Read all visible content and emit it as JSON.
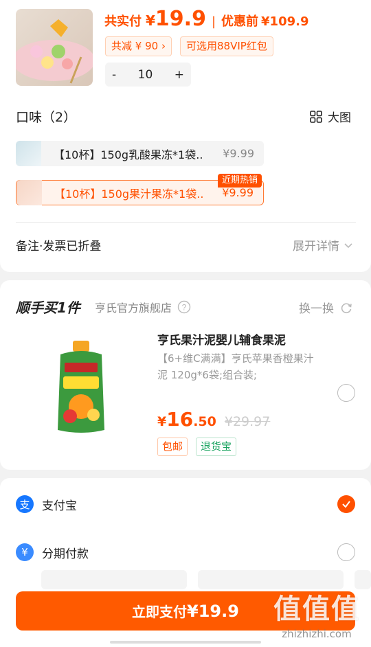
{
  "product": {
    "paid_label": "共实付",
    "currency": "¥",
    "paid_price": "19.9",
    "before_label": "优惠前",
    "before_price": "¥109.9",
    "discount_chip": "共减 ¥ 90",
    "discount_chevron": "›",
    "coupon_chip": "可选用88VIP红包",
    "quantity": "10",
    "minus": "-",
    "plus": "+"
  },
  "flavor": {
    "title": "口味（2）",
    "big_view": "大图",
    "items": [
      {
        "name": "【10杯】150g乳酸果冻*1袋..",
        "price": "¥9.99"
      },
      {
        "name": "【10杯】150g果汁果冻*1袋..",
        "price": "¥9.99"
      }
    ],
    "hot_tag": "近期热销"
  },
  "remark": {
    "label": "备注·发票已折叠",
    "expand": "展开详情"
  },
  "addon": {
    "title": "顺手买1件",
    "store": "亨氏官方旗舰店",
    "swap": "换一换",
    "product_title": "亨氏果汁泥婴儿辅食果泥",
    "product_desc": "【6+维C满满】亨氏苹果香橙果汁泥 120g*6袋;组合装;",
    "price_currency": "¥",
    "price_int": "16",
    "price_dec": ".50",
    "old_price": "¥29.97",
    "tag_free_ship": "包邮",
    "tag_return": "退货宝"
  },
  "payment": {
    "alipay": "支付宝",
    "installment": "分期付款",
    "pay_button_label": "立即支付",
    "pay_button_amount": "¥19.9",
    "watermark_main": "值值值",
    "watermark_url": "zhizhizhi.com"
  },
  "colors": {
    "accent": "#ff5000",
    "alipay_blue": "#1677ff",
    "installment_blue": "#3a8bff",
    "green": "#19a35f"
  }
}
